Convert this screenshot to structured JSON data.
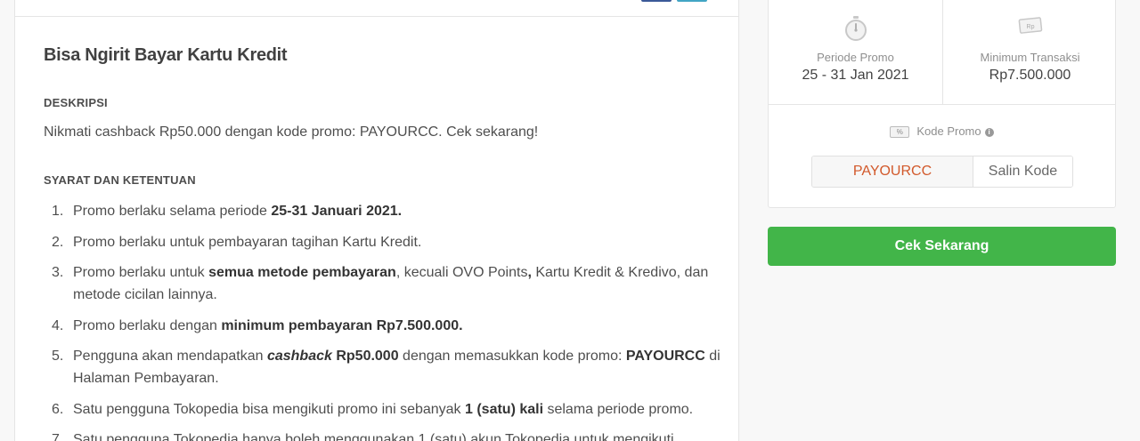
{
  "promo": {
    "title": "Bisa Ngirit Bayar Kartu Kredit",
    "description_label": "DESKRIPSI",
    "description": "Nikmati cashback Rp50.000 dengan kode promo: PAYOURCC. Cek sekarang!",
    "terms_label": "SYARAT DAN KETENTUAN",
    "terms": [
      {
        "num": "1.",
        "parts": [
          {
            "t": "Promo berlaku selama periode ",
            "b": false
          },
          {
            "t": "25-31 Januari 2021.",
            "b": true
          }
        ]
      },
      {
        "num": "2.",
        "parts": [
          {
            "t": "Promo berlaku untuk pembayaran tagihan Kartu Kredit.",
            "b": false
          }
        ]
      },
      {
        "num": "3.",
        "parts": [
          {
            "t": "Promo berlaku untuk ",
            "b": false
          },
          {
            "t": "semua metode pembayaran",
            "b": true
          },
          {
            "t": ", kecuali OVO Points",
            "b": false
          },
          {
            "t": ",",
            "b": true
          },
          {
            "t": " Kartu Kredit & Kredivo, dan metode cicilan lainnya.",
            "b": false
          }
        ]
      },
      {
        "num": "4.",
        "parts": [
          {
            "t": "Promo berlaku dengan ",
            "b": false
          },
          {
            "t": "minimum pembayaran Rp7.500.000.",
            "b": true
          }
        ]
      },
      {
        "num": "5.",
        "parts": [
          {
            "t": "Pengguna akan mendapatkan ",
            "b": false
          },
          {
            "t": "cashback",
            "b": true,
            "i": true
          },
          {
            "t": " Rp50.000",
            "b": true
          },
          {
            "t": " dengan memasukkan kode promo: ",
            "b": false
          },
          {
            "t": "PAYOURCC",
            "b": true
          },
          {
            "t": " di Halaman Pembayaran.",
            "b": false
          }
        ]
      },
      {
        "num": "6.",
        "parts": [
          {
            "t": "Satu pengguna Tokopedia bisa mengikuti promo ini sebanyak ",
            "b": false
          },
          {
            "t": "1 (satu) kali",
            "b": true
          },
          {
            "t": " selama periode promo.",
            "b": false
          }
        ]
      },
      {
        "num": "7.",
        "parts": [
          {
            "t": "Satu pengguna Tokopedia hanya boleh menggunakan 1 (satu) akun Tokopedia untuk mengikuti",
            "b": false
          }
        ]
      }
    ]
  },
  "sidebar": {
    "period_label": "Periode Promo",
    "period_value": "25 - 31 Jan 2021",
    "min_label": "Minimum Transaksi",
    "min_value": "Rp7.500.000",
    "code_label": "Kode Promo",
    "pct_icon_text": "%",
    "money_icon_text": "Rp",
    "info_glyph": "i",
    "code_value": "PAYOURCC",
    "copy_label": "Salin Kode",
    "cta_label": "Cek Sekarang"
  },
  "colors": {
    "cta": "#42b549",
    "code_text": "#d2592b",
    "facebook": "#3b5998",
    "twitter": "#42a5c4"
  },
  "icons": [
    "stopwatch-icon",
    "money-icon",
    "percent-icon",
    "info-icon",
    "facebook-share-icon",
    "twitter-share-icon"
  ]
}
